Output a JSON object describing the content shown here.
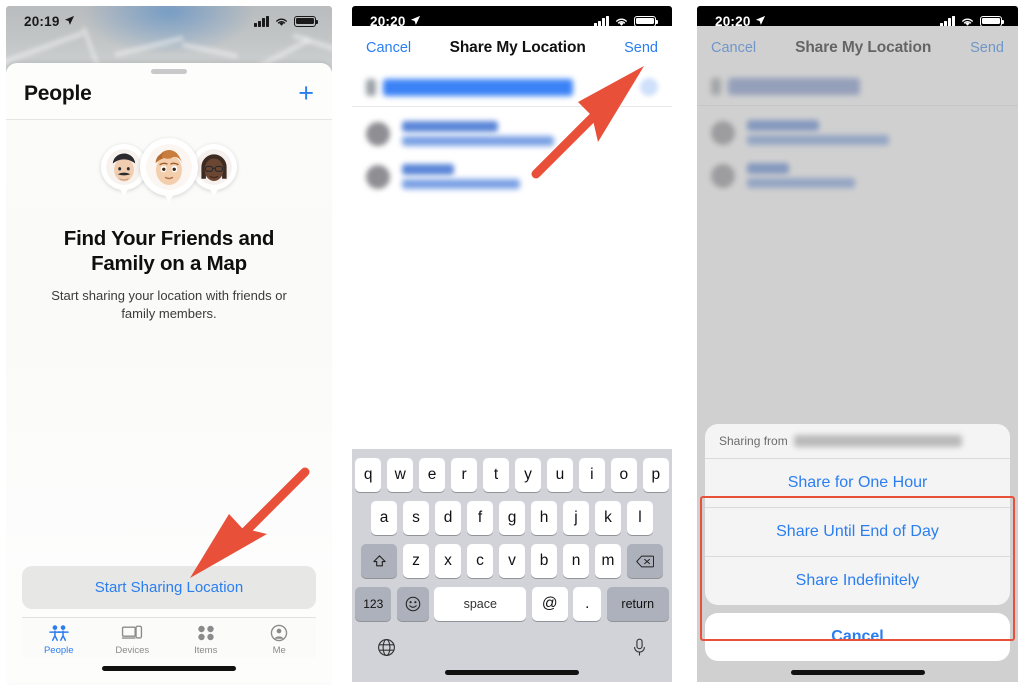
{
  "panels": [
    {
      "id": "find-my-people",
      "status_bar": {
        "time": "20:19",
        "location_icon": "location-arrow-icon",
        "signal_icon": "cellular-signal-icon",
        "wifi_icon": "wifi-icon",
        "battery_icon": "battery-icon"
      },
      "header": {
        "title": "People",
        "add_button": "+"
      },
      "empty_state": {
        "headline": "Find Your Friends and Family on a Map",
        "subline": "Start sharing your location with friends or family members.",
        "avatars": [
          "memoji-avatar-left",
          "memoji-avatar-center",
          "memoji-avatar-right"
        ]
      },
      "primary_button": "Start Sharing Location",
      "tabs": [
        {
          "label": "People",
          "icon": "people-icon",
          "active": true
        },
        {
          "label": "Devices",
          "icon": "devices-icon",
          "active": false
        },
        {
          "label": "Items",
          "icon": "items-icon",
          "active": false
        },
        {
          "label": "Me",
          "icon": "person-circle-icon",
          "active": false
        }
      ]
    },
    {
      "id": "share-my-location-compose",
      "status_bar": {
        "time": "20:20"
      },
      "navbar": {
        "cancel": "Cancel",
        "title": "Share My Location",
        "send": "Send"
      },
      "to_field": {
        "label": "To:",
        "value_redacted": true
      },
      "suggestions_redacted": 2,
      "keyboard": {
        "row1": [
          "q",
          "w",
          "e",
          "r",
          "t",
          "y",
          "u",
          "i",
          "o",
          "p"
        ],
        "row2": [
          "a",
          "s",
          "d",
          "f",
          "g",
          "h",
          "j",
          "k",
          "l"
        ],
        "row3": [
          "z",
          "x",
          "c",
          "v",
          "b",
          "n",
          "m"
        ],
        "shift": "shift-key",
        "backspace": "backspace-key",
        "numbers": "123",
        "emoji": "emoji-key",
        "space": "space",
        "at": "@",
        "dot": ".",
        "return": "return",
        "globe": "globe-key",
        "mic": "microphone-key"
      }
    },
    {
      "id": "share-duration-action-sheet",
      "status_bar": {
        "time": "20:20"
      },
      "navbar": {
        "cancel": "Cancel",
        "title": "Share My Location",
        "send": "Send"
      },
      "action_sheet": {
        "header_label": "Sharing from",
        "header_value_redacted": true,
        "options": [
          "Share for One Hour",
          "Share Until End of Day",
          "Share Indefinitely"
        ],
        "cancel": "Cancel"
      }
    }
  ],
  "annotations": {
    "arrow_color": "#e8503a",
    "highlight_color": "#e8503a",
    "arrows": [
      {
        "name": "arrow-to-start-sharing-location",
        "points_to": "Start Sharing Location"
      },
      {
        "name": "arrow-to-send-button",
        "points_to": "Send"
      }
    ],
    "highlights": [
      {
        "name": "highlight-share-duration-options",
        "surrounds": "share duration options"
      }
    ]
  }
}
